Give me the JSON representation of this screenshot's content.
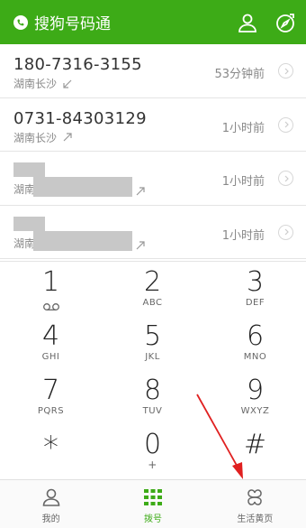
{
  "header": {
    "app_title": "搜狗号码通",
    "logo_icon": "phone-bubble-icon",
    "user_icon": "user-icon",
    "dial_icon": "compass-icon",
    "bg_color": "#3dab17"
  },
  "calls": [
    {
      "number": "180-7316-3155",
      "location": "湖南长沙",
      "direction": "incoming",
      "time": "53分钟前"
    },
    {
      "number": "0731-84303129",
      "location": "湖南长沙",
      "direction": "outgoing",
      "time": "1小时前"
    },
    {
      "number": "",
      "location": "湖南",
      "direction": "outgoing",
      "time": "1小时前",
      "masked": true
    },
    {
      "number": "",
      "location": "湖南",
      "direction": "outgoing",
      "time": "1小时前",
      "masked": true
    }
  ],
  "dialpad": {
    "keys": [
      {
        "digit": "1",
        "letters": "",
        "sub": "voicemail-icon"
      },
      {
        "digit": "2",
        "letters": "ABC"
      },
      {
        "digit": "3",
        "letters": "DEF"
      },
      {
        "digit": "4",
        "letters": "GHI"
      },
      {
        "digit": "5",
        "letters": "JKL"
      },
      {
        "digit": "6",
        "letters": "MNO"
      },
      {
        "digit": "7",
        "letters": "PQRS"
      },
      {
        "digit": "8",
        "letters": "TUV"
      },
      {
        "digit": "9",
        "letters": "WXYZ"
      },
      {
        "digit": "*",
        "letters": ""
      },
      {
        "digit": "0",
        "letters": "+"
      },
      {
        "digit": "#",
        "letters": ""
      }
    ]
  },
  "bottom_nav": [
    {
      "label": "我的",
      "icon": "person-icon",
      "active": false
    },
    {
      "label": "拨号",
      "icon": "dialpad-icon",
      "active": true
    },
    {
      "label": "生活黄页",
      "icon": "clover-icon",
      "active": false
    }
  ],
  "colors": {
    "accent": "#3dab17",
    "annotation": "#e02020"
  }
}
